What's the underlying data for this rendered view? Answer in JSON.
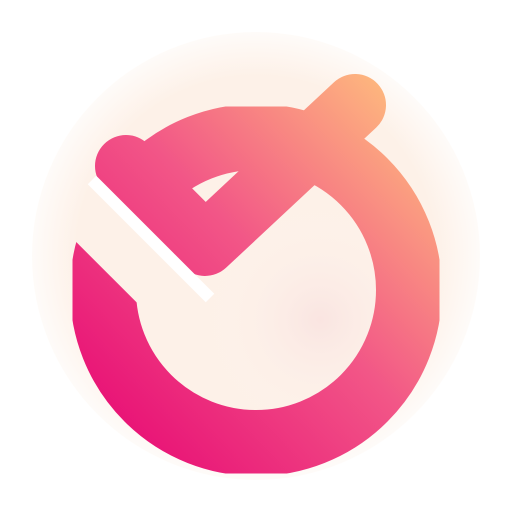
{
  "logo": {
    "icon": "check-ring-icon",
    "colors": {
      "gradient_start": "#E80E75",
      "gradient_mid": "#F25687",
      "gradient_end": "#FFC17D",
      "background_glow": "#FDF1E8",
      "inner_glow": "#F9E3E0",
      "cut": "#FFFFFF"
    }
  }
}
